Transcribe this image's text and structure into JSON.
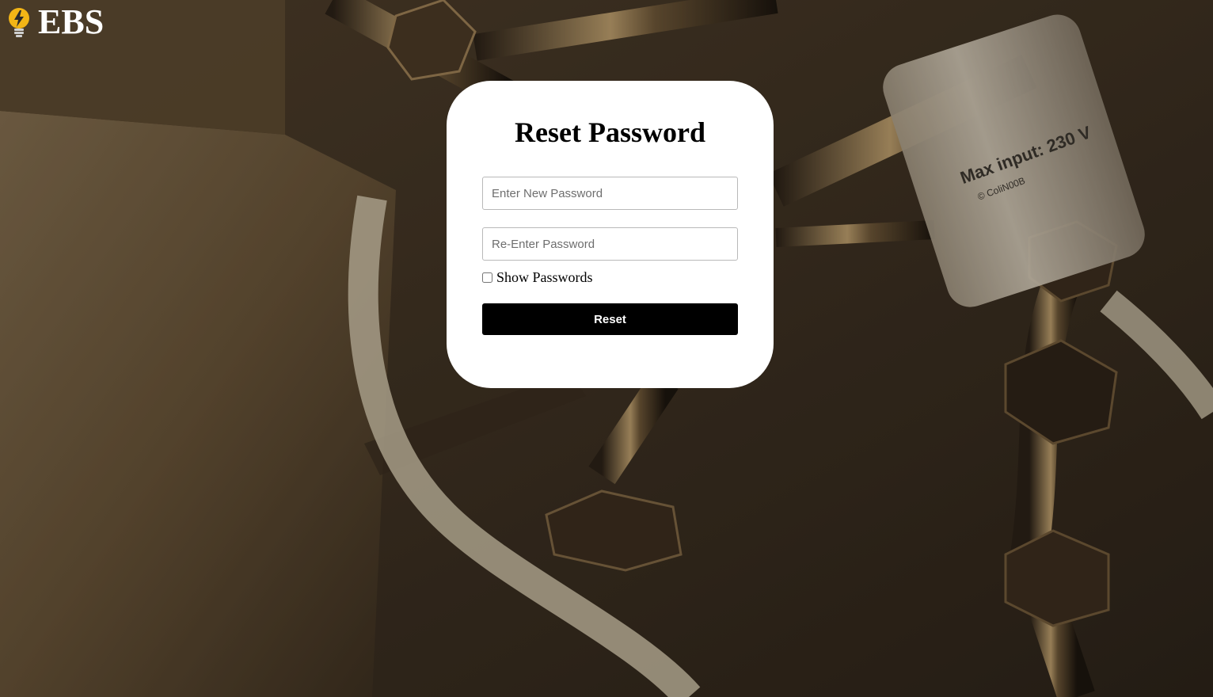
{
  "brand": {
    "name": "EBS",
    "icon": "lightbulb-bolt-icon",
    "icon_color": "#f2b516"
  },
  "background": {
    "label_text": "Max input: 230 V",
    "label_subtext": "© ColiN00B"
  },
  "reset_form": {
    "title": "Reset Password",
    "new_password_placeholder": "Enter New Password",
    "reenter_password_placeholder": "Re-Enter Password",
    "show_passwords_label": "Show Passwords",
    "show_passwords_checked": false,
    "reset_button_label": "Reset"
  },
  "colors": {
    "card": "#ffffff",
    "button": "#000000",
    "button_text": "#ffffff"
  }
}
